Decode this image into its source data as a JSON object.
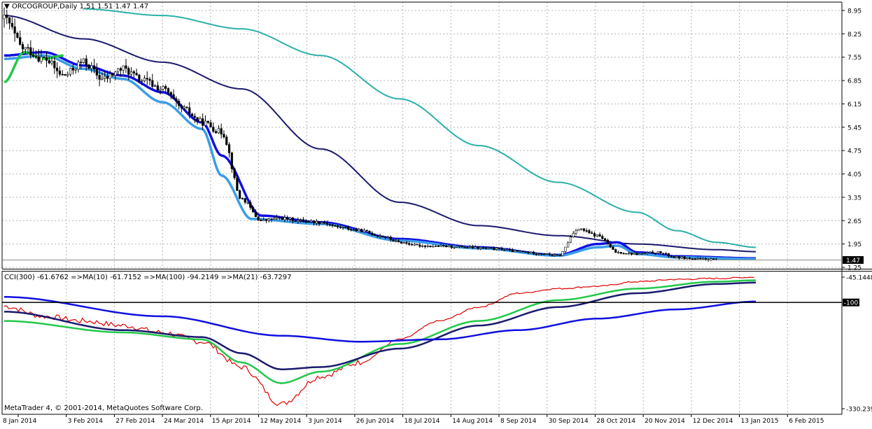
{
  "header": {
    "symbol_line": "ORCOGROUP,Daily  1.51 1.51 1.47 1.47"
  },
  "indicator_header": "CCI(300) -61.6762  =>MA(10) -61.7152  =>MA(100) -94.2149  =>MA(21) -63.7297",
  "copyright": "MetaTrader 4, © 2001-2014, MetaQuotes Software Corp.",
  "colors": {
    "background": "#ffffff",
    "grid": "#b4b4b4",
    "candle": "#000000",
    "ma_teal": "#2ab0a8",
    "ma_navy": "#1a1a6e",
    "ma_blue": "#1010e0",
    "ma_lightblue": "#3a9de8",
    "ma_green": "#22c84a",
    "cci": "#e00000"
  },
  "chart_data": [
    {
      "type": "candlestick",
      "title": "ORCOGROUP,Daily",
      "ohlc_last": {
        "open": 1.51,
        "high": 1.51,
        "low": 1.47,
        "close": 1.47
      },
      "current_price_label": "1.47",
      "x_tick_labels": [
        "8 Jan 2014",
        "3 Feb 2014",
        "27 Feb 2014",
        "24 Mar 2014",
        "15 Apr 2014",
        "12 May 2014",
        "3 Jun 2014",
        "26 Jun 2014",
        "18 Jul 2014",
        "14 Aug 2014",
        "8 Sep 2014",
        "30 Sep 2014",
        "28 Oct 2014",
        "20 Nov 2014",
        "12 Dec 2014",
        "13 Jan 2015",
        "6 Feb 2015"
      ],
      "y_tick_labels": [
        "8.95",
        "8.25",
        "7.55",
        "6.85",
        "6.15",
        "5.45",
        "4.75",
        "4.05",
        "3.35",
        "2.65",
        "1.95",
        "1.25"
      ],
      "ylim": [
        1.2,
        9.1
      ],
      "grid": true,
      "price_anchors": [
        [
          0,
          8.7
        ],
        [
          1,
          7.8
        ],
        [
          2,
          7.5
        ],
        [
          3,
          7.0
        ],
        [
          4,
          7.4
        ],
        [
          5,
          6.9
        ],
        [
          6,
          7.2
        ],
        [
          7,
          6.85
        ],
        [
          8,
          6.6
        ],
        [
          9,
          6.0
        ],
        [
          10,
          5.6
        ],
        [
          11,
          5.3
        ],
        [
          12,
          3.3
        ],
        [
          13,
          2.65
        ],
        [
          14,
          2.72
        ],
        [
          15,
          2.65
        ],
        [
          16,
          2.6
        ],
        [
          17,
          2.45
        ],
        [
          18,
          2.35
        ],
        [
          19,
          2.2
        ],
        [
          20,
          2.0
        ],
        [
          21,
          1.9
        ],
        [
          22,
          1.88
        ],
        [
          23,
          1.87
        ],
        [
          24,
          1.83
        ],
        [
          25,
          1.8
        ],
        [
          26,
          1.72
        ],
        [
          27,
          1.67
        ],
        [
          28,
          1.6
        ],
        [
          29,
          2.4
        ],
        [
          30,
          2.2
        ],
        [
          31,
          1.7
        ],
        [
          32,
          1.65
        ],
        [
          33,
          1.7
        ],
        [
          34,
          1.55
        ],
        [
          35,
          1.5
        ],
        [
          36,
          1.48
        ]
      ],
      "series": [
        {
          "name": "MA teal",
          "color": "#2ab0a8",
          "points": [
            [
              4,
              9.0
            ],
            [
              8,
              8.8
            ],
            [
              12,
              8.4
            ],
            [
              16,
              7.6
            ],
            [
              20,
              6.3
            ],
            [
              24,
              4.9
            ],
            [
              28,
              3.8
            ],
            [
              32,
              2.9
            ],
            [
              34,
              2.35
            ],
            [
              36,
              2.0
            ],
            [
              38,
              1.85
            ]
          ]
        },
        {
          "name": "MA navy",
          "color": "#1a1a6e",
          "points": [
            [
              0,
              8.8
            ],
            [
              4,
              8.1
            ],
            [
              8,
              7.4
            ],
            [
              12,
              6.6
            ],
            [
              16,
              4.8
            ],
            [
              20,
              3.2
            ],
            [
              24,
              2.5
            ],
            [
              28,
              2.2
            ],
            [
              32,
              1.95
            ],
            [
              36,
              1.78
            ],
            [
              38,
              1.72
            ]
          ]
        },
        {
          "name": "MA blue",
          "color": "#1010e0",
          "points": [
            [
              0,
              7.6
            ],
            [
              2,
              7.7
            ],
            [
              4,
              7.3
            ],
            [
              6,
              7.0
            ],
            [
              8,
              6.5
            ],
            [
              10,
              5.6
            ],
            [
              11,
              4.6
            ],
            [
              13,
              2.8
            ],
            [
              16,
              2.6
            ],
            [
              20,
              2.1
            ],
            [
              24,
              1.85
            ],
            [
              28,
              1.62
            ],
            [
              30,
              1.95
            ],
            [
              31,
              2.0
            ],
            [
              32,
              1.7
            ],
            [
              34,
              1.58
            ],
            [
              38,
              1.52
            ]
          ]
        },
        {
          "name": "MA light blue",
          "color": "#3a9de8",
          "points": [
            [
              0,
              7.5
            ],
            [
              2,
              7.6
            ],
            [
              4,
              7.2
            ],
            [
              6,
              6.9
            ],
            [
              8,
              6.2
            ],
            [
              10,
              5.4
            ],
            [
              11,
              4.0
            ],
            [
              12.5,
              2.7
            ],
            [
              16,
              2.55
            ],
            [
              20,
              2.05
            ],
            [
              24,
              1.82
            ],
            [
              28,
              1.6
            ],
            [
              30,
              1.85
            ],
            [
              31,
              1.9
            ],
            [
              32,
              1.65
            ],
            [
              34,
              1.55
            ],
            [
              38,
              1.5
            ]
          ]
        },
        {
          "name": "MA green",
          "color": "#22c84a",
          "points": [
            [
              0,
              6.8
            ],
            [
              1,
              7.7
            ],
            [
              2,
              7.5
            ],
            [
              3,
              7.6
            ]
          ]
        }
      ]
    },
    {
      "type": "line",
      "title": "CCI(300)",
      "y_tick_labels": [
        "-45.1448",
        "-100",
        "-330.239"
      ],
      "ylim": [
        -330.239,
        -40
      ],
      "reference_line": -100,
      "series": [
        {
          "name": "CCI(300)",
          "color": "#e00000",
          "points": [
            [
              0,
              -108
            ],
            [
              1,
              -130
            ],
            [
              2,
              -140
            ],
            [
              3,
              -150
            ],
            [
              4,
              -165
            ],
            [
              5,
              -185
            ],
            [
              6,
              -240
            ],
            [
              7,
              -320
            ],
            [
              8,
              -260
            ],
            [
              9,
              -230
            ],
            [
              10,
              -180
            ],
            [
              11,
              -140
            ],
            [
              12,
              -110
            ],
            [
              13,
              -80
            ],
            [
              14,
              -70
            ],
            [
              15,
              -65
            ],
            [
              16,
              -55
            ],
            [
              17,
              -50
            ],
            [
              18,
              -48
            ],
            [
              19,
              -45
            ]
          ]
        },
        {
          "name": "MA(10)",
          "color": "#22c84a",
          "points": [
            [
              0,
              -140
            ],
            [
              3,
              -165
            ],
            [
              5,
              -180
            ],
            [
              6,
              -230
            ],
            [
              7,
              -275
            ],
            [
              8,
              -250
            ],
            [
              10,
              -190
            ],
            [
              12,
              -140
            ],
            [
              14,
              -95
            ],
            [
              16,
              -70
            ],
            [
              18,
              -55
            ],
            [
              19,
              -52
            ]
          ]
        },
        {
          "name": "MA(21)",
          "color": "#1a1a6e",
          "points": [
            [
              0,
              -120
            ],
            [
              3,
              -160
            ],
            [
              5,
              -175
            ],
            [
              6,
              -210
            ],
            [
              7,
              -245
            ],
            [
              8,
              -240
            ],
            [
              10,
              -200
            ],
            [
              12,
              -150
            ],
            [
              14,
              -110
            ],
            [
              16,
              -80
            ],
            [
              18,
              -60
            ],
            [
              19,
              -57
            ]
          ]
        },
        {
          "name": "MA(100)",
          "color": "#1010e0",
          "points": [
            [
              0,
              -88
            ],
            [
              4,
              -130
            ],
            [
              7,
              -172
            ],
            [
              9,
              -185
            ],
            [
              11,
              -180
            ],
            [
              13,
              -160
            ],
            [
              15,
              -135
            ],
            [
              17,
              -115
            ],
            [
              19,
              -98
            ]
          ]
        }
      ]
    }
  ]
}
